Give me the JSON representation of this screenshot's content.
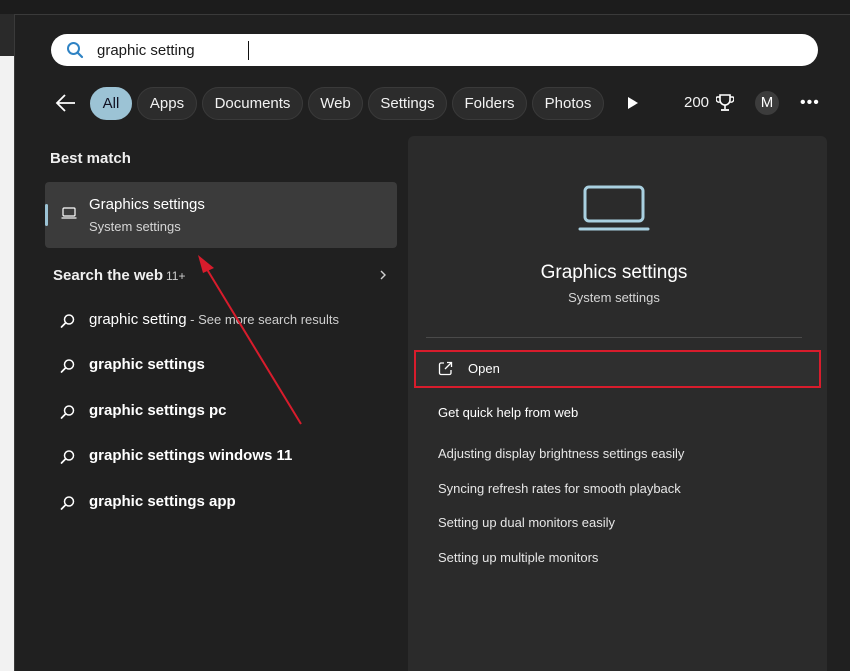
{
  "search": {
    "value": "graphic setting"
  },
  "filters": [
    "All",
    "Apps",
    "Documents",
    "Web",
    "Settings",
    "Folders",
    "Photos"
  ],
  "toolbar": {
    "points": "200",
    "avatar_initial": "M"
  },
  "best_match": {
    "label": "Best match",
    "title": "Graphics settings",
    "subtitle": "System settings"
  },
  "web": {
    "label": "Search the web",
    "count": "11+",
    "results": [
      {
        "text": "graphic setting",
        "suffix": " - See more search results"
      },
      {
        "text": "graphic settings",
        "suffix": ""
      },
      {
        "text": "graphic settings pc",
        "suffix": ""
      },
      {
        "text": "graphic settings windows 11",
        "suffix": ""
      },
      {
        "text": "graphic settings app",
        "suffix": ""
      }
    ]
  },
  "details": {
    "title": "Graphics settings",
    "subtitle": "System settings",
    "open_label": "Open",
    "help_label": "Get quick help from web",
    "links": [
      "Adjusting display brightness settings easily",
      "Syncing refresh rates for smooth playback",
      "Setting up dual monitors easily",
      "Setting up multiple monitors"
    ]
  },
  "colors": {
    "accent": "#9cc3d5",
    "annotation": "#d81c2c",
    "panel": "#202020",
    "details_panel": "#2b2b2b"
  },
  "icons": [
    "search-icon",
    "back-arrow-icon",
    "play-icon",
    "trophy-icon",
    "more-icon",
    "laptop-icon",
    "chevron-right-icon",
    "magnifier-icon",
    "open-external-icon"
  ]
}
